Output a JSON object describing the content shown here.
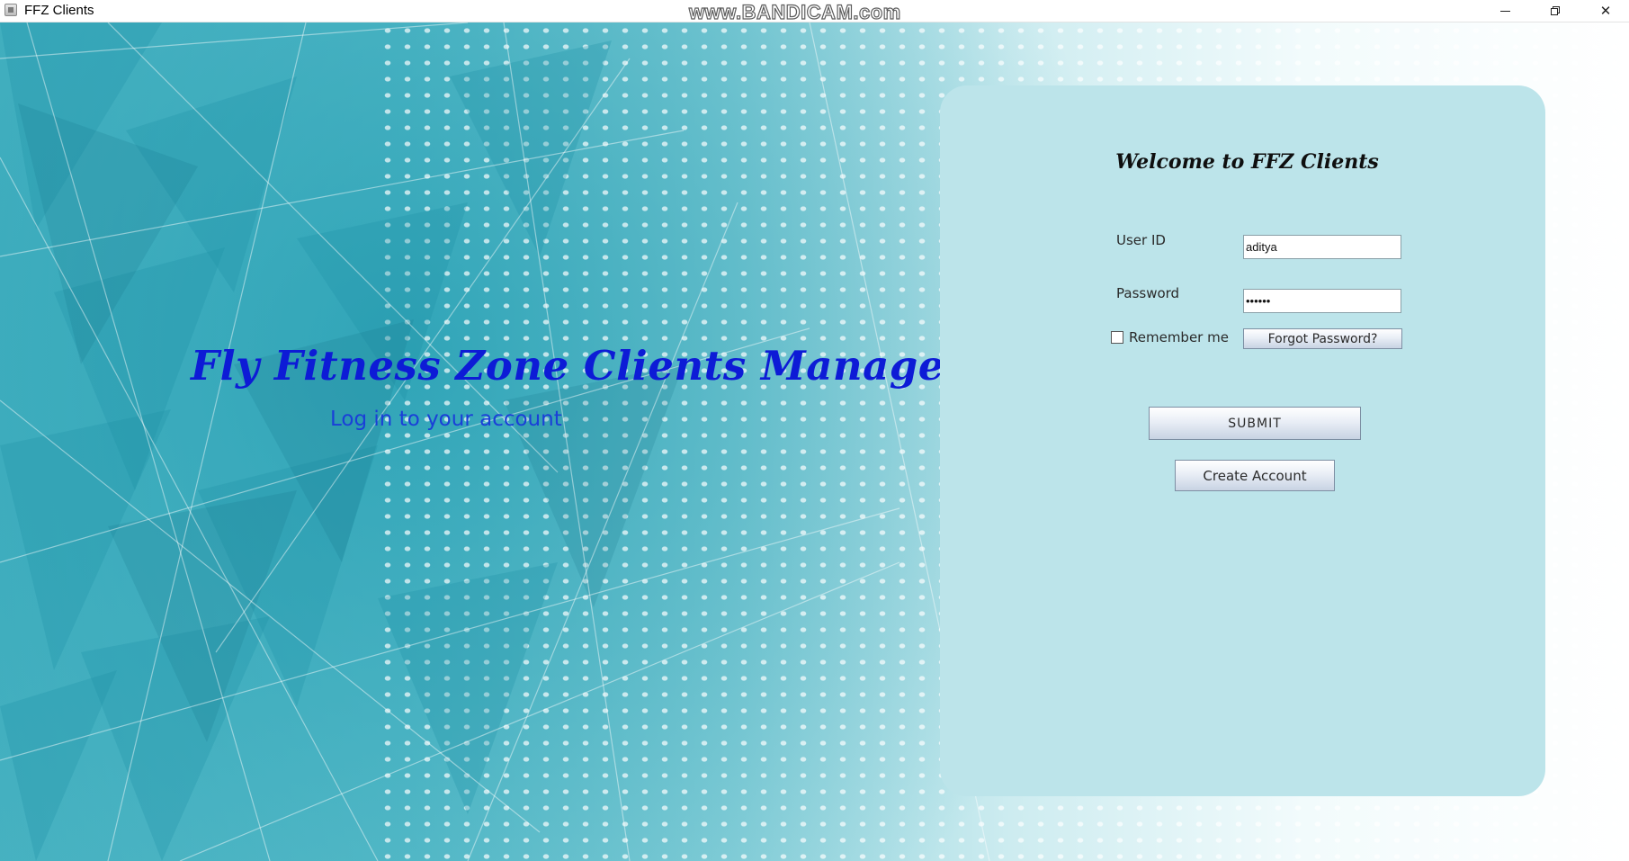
{
  "window": {
    "title": "FFZ Clients",
    "watermark": "www.BANDICAM.com",
    "controls": {
      "minimize_icon": "minimize-icon",
      "maximize_icon": "restore-icon",
      "close_glyph": "✕"
    }
  },
  "brand": {
    "title": "Fly Fitness Zone Clients Manager",
    "subtitle": "Log in to your account",
    "title_color": "#0d1bd6",
    "subtitle_color": "#1a3fd8"
  },
  "login": {
    "heading": "Welcome to FFZ Clients",
    "user_id_label": "User ID",
    "user_id_value": "aditya",
    "password_label": "Password",
    "password_value": "••••••",
    "remember_label": "Remember me",
    "remember_checked": false,
    "forgot_label": "Forgot Password?",
    "submit_label": "SUBMIT",
    "create_label": "Create Account",
    "panel_color": "#bce4ea"
  }
}
